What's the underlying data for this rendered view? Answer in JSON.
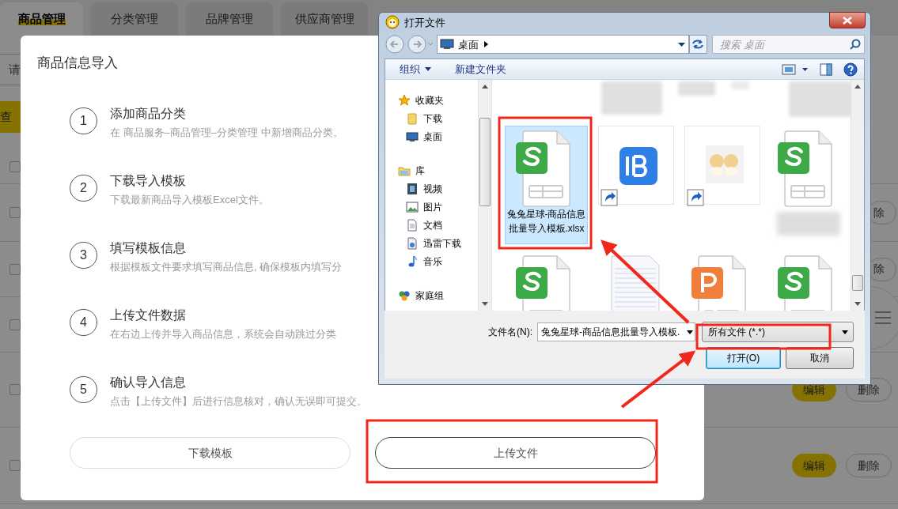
{
  "page": {
    "tabs": [
      {
        "label": "商品管理",
        "selected": true
      },
      {
        "label": "分类管理",
        "selected": false
      },
      {
        "label": "品牌管理",
        "selected": false
      },
      {
        "label": "供应商管理",
        "selected": false
      }
    ],
    "search": {
      "placeholder": "请"
    },
    "query_button": "查",
    "table": {
      "header_checked": false,
      "rows": [
        {
          "checked": false,
          "buttons": [
            {
              "kind": "delete",
              "label": "除"
            }
          ]
        },
        {
          "checked": false,
          "buttons": [
            {
              "kind": "delete",
              "label": "除"
            }
          ]
        },
        {
          "checked": false,
          "buttons": []
        },
        {
          "checked": false,
          "buttons": [
            {
              "kind": "edit",
              "label": "编辑"
            },
            {
              "kind": "delete",
              "label": "删除"
            }
          ]
        },
        {
          "checked": false,
          "buttons": [
            {
              "kind": "edit",
              "label": "编辑"
            },
            {
              "kind": "delete",
              "label": "删除"
            }
          ]
        }
      ]
    }
  },
  "import_dialog": {
    "title": "商品信息导入",
    "steps": [
      {
        "number": "1",
        "title": "添加商品分类",
        "description": "在 商品服务–商品管理–分类管理 中新增商品分类。"
      },
      {
        "number": "2",
        "title": "下载导入模板",
        "description": "下载最新商品导入模板Excel文件。"
      },
      {
        "number": "3",
        "title": "填写模板信息",
        "description": "根据模板文件要求填写商品信息, 确保模板内填写分"
      },
      {
        "number": "4",
        "title": "上传文件数据",
        "description": "在右边上传并导入商品信息，系统会自动跳过分类"
      },
      {
        "number": "5",
        "title": "确认导入信息",
        "description": "点击【上传文件】后进行信息核对，确认无误即可提交。"
      }
    ],
    "buttons": [
      {
        "label": "下载模板",
        "selected": false
      },
      {
        "label": "上传文件",
        "selected": true
      }
    ]
  },
  "file_dialog": {
    "title": "打开文件",
    "address": "桌面",
    "search": {
      "placeholder": "搜索 桌面"
    },
    "toolbar": [
      "组织",
      "新建文件夹"
    ],
    "sidebar": [
      {
        "label": "收藏夹",
        "kind": "favorites",
        "children": [
          {
            "label": "下载",
            "kind": "folder"
          },
          {
            "label": "桌面",
            "kind": "desktop"
          }
        ]
      },
      {
        "label": "库",
        "kind": "library",
        "children": [
          {
            "label": "视频",
            "kind": "video"
          },
          {
            "label": "图片",
            "kind": "pictures"
          },
          {
            "label": "文档",
            "kind": "documents"
          },
          {
            "label": "迅雷下载",
            "kind": "download"
          },
          {
            "label": "音乐",
            "kind": "music"
          }
        ]
      },
      {
        "label": "家庭组",
        "kind": "homegroup"
      }
    ],
    "files": [
      {
        "kind": "spreadsheet",
        "selected": true,
        "label": "兔兔星球-商品信息批量导入模板.xlsx"
      },
      {
        "kind": "app-shortcut",
        "selected": false
      },
      {
        "kind": "image-shortcut",
        "selected": false
      },
      {
        "kind": "spreadsheet",
        "selected": false
      },
      {
        "kind": "spreadsheet",
        "selected": false
      },
      {
        "kind": "text",
        "selected": false
      },
      {
        "kind": "presentation",
        "selected": false
      },
      {
        "kind": "spreadsheet",
        "selected": false
      }
    ],
    "file_name_label": "文件名(N):",
    "file_name": "兔兔星球-商品信息批量导入模板.",
    "file_type": "所有文件 (*.*)",
    "buttons": [
      {
        "label": "打开(O)",
        "kind": "default"
      },
      {
        "label": "取消",
        "kind": "normal"
      }
    ]
  }
}
